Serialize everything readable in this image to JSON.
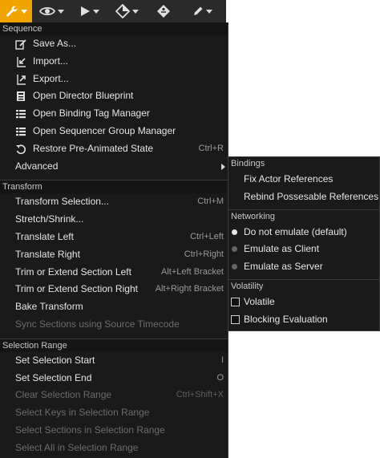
{
  "toolbar": {
    "buttons": [
      {
        "icon": "wrench-icon",
        "active": true
      },
      {
        "icon": "eye-icon",
        "active": false
      },
      {
        "icon": "play-icon",
        "active": false
      },
      {
        "icon": "diamond-key-icon",
        "active": false
      },
      {
        "icon": "key-tag-icon",
        "active": false
      },
      {
        "icon": "pencil-icon",
        "active": false
      }
    ],
    "accent": "#f0a400"
  },
  "menu": {
    "sequence": {
      "header": "Sequence",
      "items": [
        {
          "label": "Save As...",
          "icon": "save-as-icon"
        },
        {
          "label": "Import...",
          "icon": "import-icon"
        },
        {
          "label": "Export...",
          "icon": "export-icon"
        },
        {
          "label": "Open Director Blueprint",
          "icon": "blueprint-icon"
        },
        {
          "label": "Open Binding Tag Manager",
          "icon": "list-icon"
        },
        {
          "label": "Open Sequencer Group Manager",
          "icon": "list-icon"
        },
        {
          "label": "Restore Pre-Animated State",
          "icon": "restore-icon",
          "shortcut": "Ctrl+R"
        },
        {
          "label": "Advanced",
          "submenu": true
        }
      ]
    },
    "transform": {
      "header": "Transform",
      "items": [
        {
          "label": "Transform Selection...",
          "shortcut": "Ctrl+M"
        },
        {
          "label": "Stretch/Shrink...",
          "shortcut": ""
        },
        {
          "label": "Translate Left",
          "shortcut": "Ctrl+Left"
        },
        {
          "label": "Translate Right",
          "shortcut": "Ctrl+Right"
        },
        {
          "label": "Trim or Extend Section Left",
          "shortcut": "Alt+Left Bracket"
        },
        {
          "label": "Trim or Extend Section Right",
          "shortcut": "Alt+Right Bracket"
        },
        {
          "label": "Bake Transform",
          "shortcut": ""
        },
        {
          "label": "Sync Sections using Source Timecode",
          "shortcut": "",
          "disabled": true
        }
      ]
    },
    "selection_range": {
      "header": "Selection Range",
      "items": [
        {
          "label": "Set Selection Start",
          "shortcut": "I"
        },
        {
          "label": "Set Selection End",
          "shortcut": "O"
        },
        {
          "label": "Clear Selection Range",
          "shortcut": "Ctrl+Shift+X",
          "disabled": true
        },
        {
          "label": "Select Keys in Selection Range",
          "shortcut": "",
          "disabled": true
        },
        {
          "label": "Select Sections in Selection Range",
          "shortcut": "",
          "disabled": true
        },
        {
          "label": "Select All in Selection Range",
          "shortcut": "",
          "disabled": true
        }
      ]
    }
  },
  "submenu": {
    "bindings": {
      "header": "Bindings",
      "items": [
        "Fix Actor References",
        "Rebind Possesable References"
      ]
    },
    "networking": {
      "header": "Networking",
      "items": [
        {
          "label": "Do not emulate (default)",
          "selected": true
        },
        {
          "label": "Emulate as Client",
          "selected": false
        },
        {
          "label": "Emulate as Server",
          "selected": false
        }
      ]
    },
    "volatility": {
      "header": "Volatility",
      "items": [
        {
          "label": "Volatile",
          "checked": false
        },
        {
          "label": "Blocking Evaluation",
          "checked": false
        }
      ]
    }
  }
}
